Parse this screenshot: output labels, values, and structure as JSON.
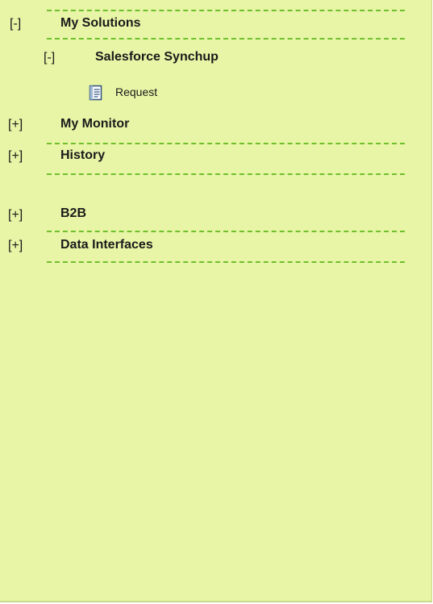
{
  "tree": {
    "my_solutions": {
      "toggle": "[-]",
      "label": "My Solutions"
    },
    "salesforce_synchup": {
      "toggle": "[-]",
      "label": "Salesforce Synchup"
    },
    "request": {
      "label": "Request",
      "icon": "document-icon"
    },
    "my_monitor": {
      "toggle": "[+]",
      "label": "My Monitor"
    },
    "history": {
      "toggle": "[+]",
      "label": "History"
    },
    "b2b": {
      "toggle": "[+]",
      "label": "B2B"
    },
    "data_interfaces": {
      "toggle": "[+]",
      "label": "Data Interfaces"
    }
  },
  "colors": {
    "panel_background": "#e8f5a6",
    "dashed_separator": "#6fc02b",
    "text": "#1a1a1a"
  }
}
